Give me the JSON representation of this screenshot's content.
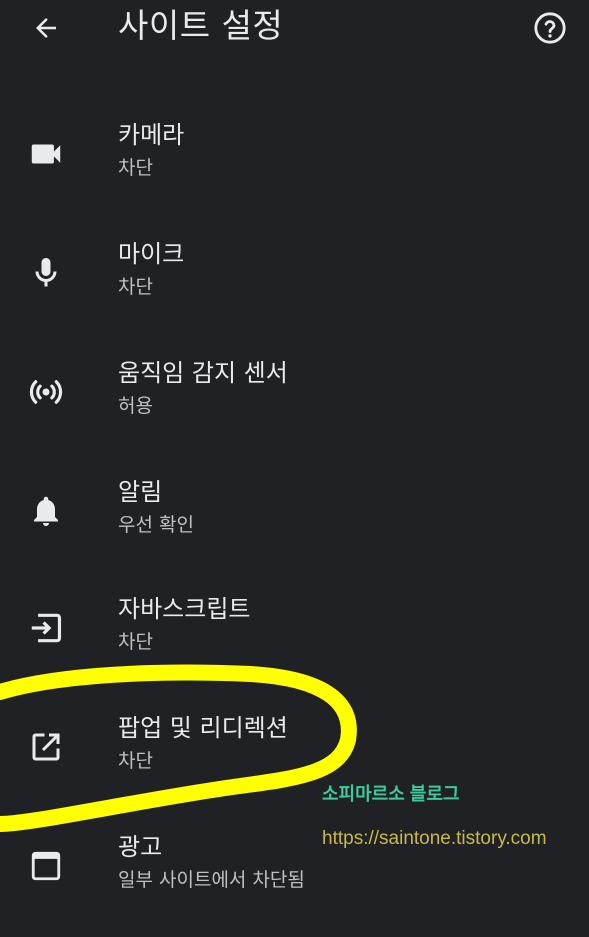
{
  "app_bar": {
    "title": "사이트 설정",
    "back_icon": "arrow-back-icon",
    "help_icon": "help-circle-icon"
  },
  "settings": [
    {
      "title": "카메라",
      "subtitle": "차단",
      "icon": "videocam-icon"
    },
    {
      "title": "마이크",
      "subtitle": "차단",
      "icon": "mic-icon"
    },
    {
      "title": "움직임 감지 센서",
      "subtitle": "허용",
      "icon": "sensors-icon"
    },
    {
      "title": "알림",
      "subtitle": "우선 확인",
      "icon": "bell-icon"
    },
    {
      "title": "자바스크립트",
      "subtitle": "차단",
      "icon": "javascript-input-icon"
    },
    {
      "title": "팝업 및 리디렉션",
      "subtitle": "차단",
      "icon": "open-in-new-icon"
    },
    {
      "title": "광고",
      "subtitle": "일부 사이트에서 차단됨",
      "icon": "ads-window-icon"
    }
  ],
  "watermark": {
    "blog_name": "소피마르소 블로그",
    "url": "https://saintone.tistory.com"
  },
  "colors": {
    "background": "#202124",
    "text_primary": "#e8eaed",
    "text_secondary": "#bdc1c6",
    "highlight": "#ffff00",
    "watermark_green": "#3ec9a0",
    "watermark_gold": "#c9b84a"
  }
}
